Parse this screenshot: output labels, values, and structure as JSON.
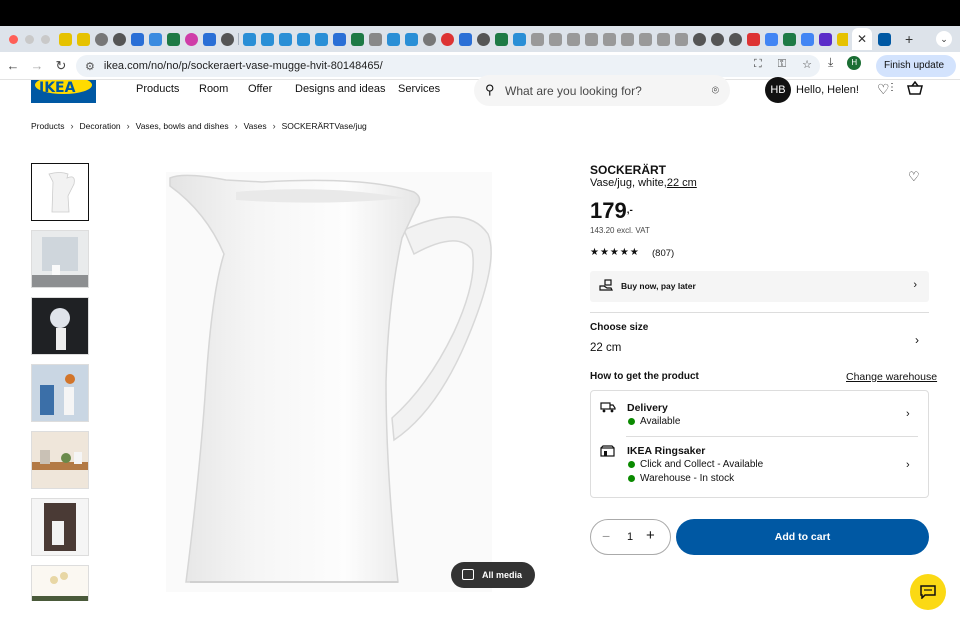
{
  "browser": {
    "url": "ikea.com/no/no/p/sockeraert-vase-mugge-hvit-80148465/",
    "finish_update_label": "Finish update",
    "profile_initial": "H",
    "tab_close_glyph": "✕",
    "new_tab_glyph": "+",
    "tab_menu_glyph": "⌄"
  },
  "site": {
    "logo_text": "IKEA",
    "nav": [
      "Products",
      "Room",
      "Offer",
      "Designs and ideas",
      "Services"
    ],
    "search_placeholder": "What are you looking for?",
    "user_initials": "HB",
    "greeting": "Hello, Helen!"
  },
  "breadcrumbs": [
    "Products",
    "Decoration",
    "Vases, bowls and dishes",
    "Vases",
    "SOCKERÄRTVase/jug"
  ],
  "product": {
    "name": "SOCKERÄRT",
    "description": "Vase/jug, white,",
    "size_link": "22 cm",
    "price_main": "179",
    "price_suffix": ",-",
    "excl_vat": "143.20 excl. VAT",
    "rating_stars": 5,
    "reviews": "(807)",
    "buy_now_label": "Buy now, pay later",
    "choose_size_label": "Choose size",
    "size_value": "22 cm",
    "how_to_get_label": "How to get the product",
    "change_warehouse_label": "Change warehouse",
    "delivery_title": "Delivery",
    "delivery_status": "Available",
    "store_title": "IKEA Ringsaker",
    "store_status_1": "Click and Collect - Available",
    "store_status_2": "Warehouse - In stock",
    "quantity": "1",
    "add_to_cart_label": "Add to cart",
    "all_media_label": "All media"
  },
  "colors": {
    "ikea_blue": "#0058a3",
    "ikea_yellow": "#ffdb00",
    "available_green": "#0a8a00",
    "chat_yellow": "#fbd914"
  }
}
